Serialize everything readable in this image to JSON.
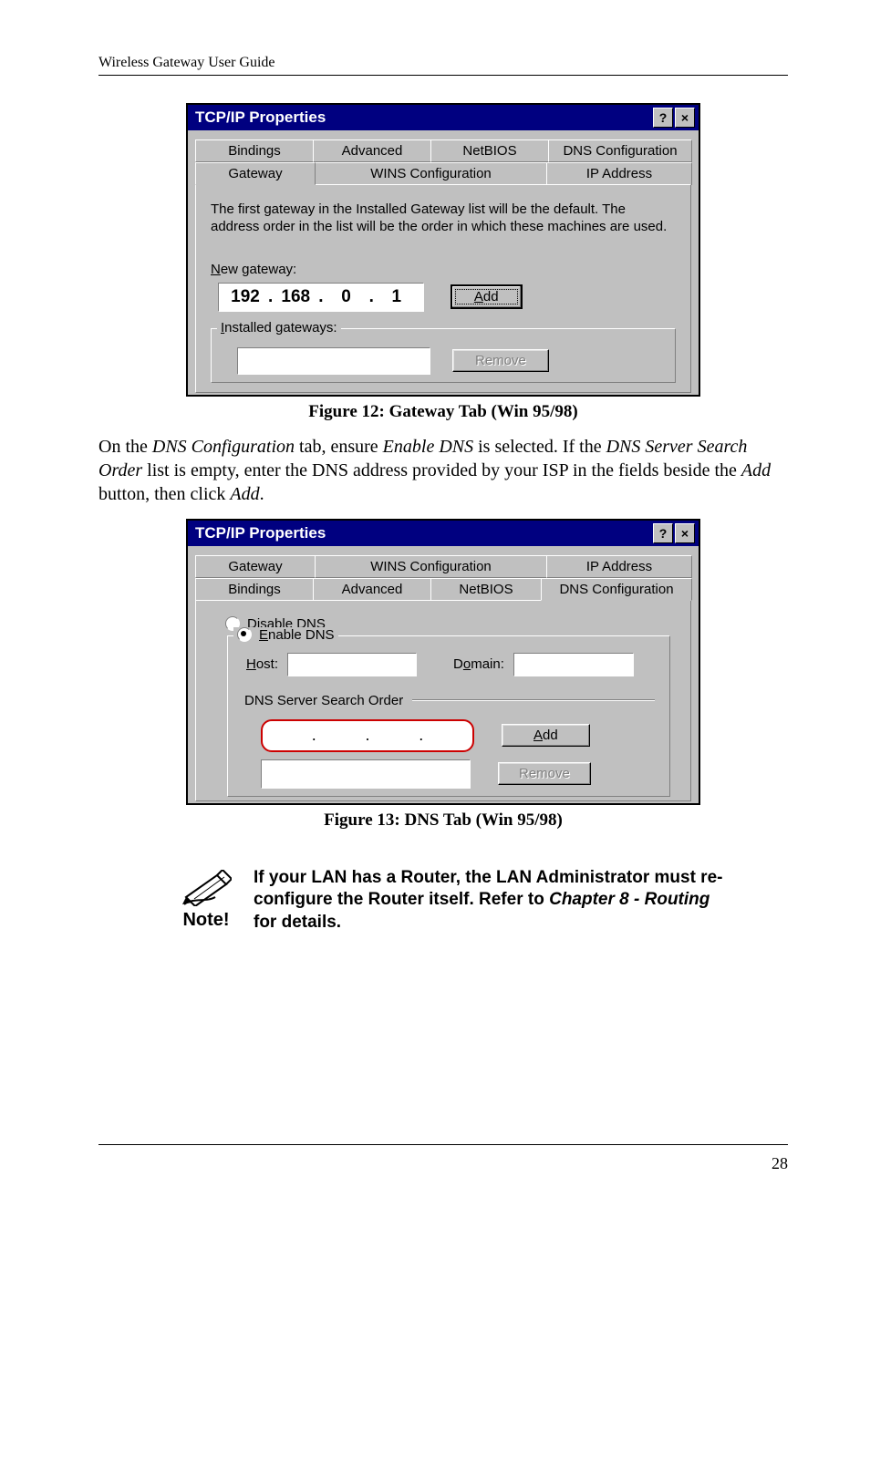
{
  "header": {
    "running_head": "Wireless Gateway User Guide"
  },
  "fig12": {
    "dialog_title": "TCP/IP Properties",
    "help_glyph": "?",
    "close_glyph": "×",
    "tabs_row1": [
      "Bindings",
      "Advanced",
      "NetBIOS",
      "DNS Configuration"
    ],
    "tabs_row2": [
      "Gateway",
      "WINS Configuration",
      "IP Address"
    ],
    "info": "The first gateway in the Installed Gateway list will be the default. The address order in the list will be the order in which these machines are used.",
    "new_gateway_label": "New gateway:",
    "ip": {
      "a": "192",
      "b": "168",
      "c": "0",
      "d": "1"
    },
    "add_label": "Add",
    "installed_label": "Installed gateways:",
    "remove_label": "Remove",
    "caption": "Figure 12: Gateway Tab (Win 95/98)"
  },
  "para": {
    "pre": "On the ",
    "i1": "DNS Configuration",
    "mid1": " tab, ensure ",
    "i2": "Enable DNS",
    "mid2": " is selected. If the ",
    "i3": "DNS Server Search Order",
    "mid3": " list is empty, enter the DNS address provided by your ISP in the fields beside the ",
    "i4": "Add",
    "mid4": " button, then click ",
    "i5": "Add",
    "post": "."
  },
  "fig13": {
    "dialog_title": "TCP/IP Properties",
    "help_glyph": "?",
    "close_glyph": "×",
    "tabs_row1": [
      "Gateway",
      "WINS Configuration",
      "IP Address"
    ],
    "tabs_row2": [
      "Bindings",
      "Advanced",
      "NetBIOS",
      "DNS Configuration"
    ],
    "disable_label": "Disable DNS",
    "enable_label": "Enable DNS",
    "host_label": "Host:",
    "domain_label": "Domain:",
    "search_label": "DNS Server Search Order",
    "add_label": "Add",
    "remove_label": "Remove",
    "caption": "Figure 13: DNS Tab (Win 95/98)"
  },
  "note": {
    "icon_label": "Note!",
    "line1": "If your LAN has a Router, the LAN Administrator must re-configure the Router itself. Refer to ",
    "chapter": "Chapter 8 - Routing",
    "line2": " for details."
  },
  "footer": {
    "page": "28"
  }
}
